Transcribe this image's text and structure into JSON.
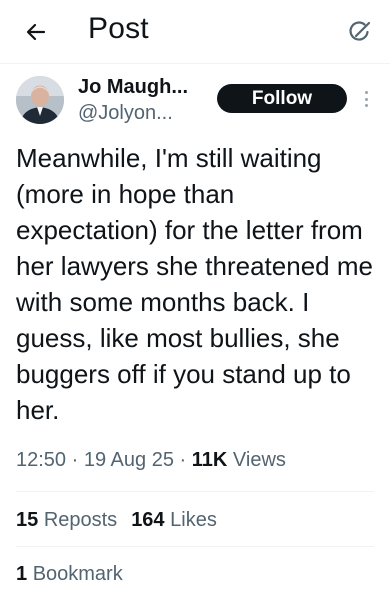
{
  "header": {
    "back_icon": "arrow-left-icon",
    "title": "Post",
    "grok_icon": "grok-icon"
  },
  "author": {
    "name": "Jo Maugh...",
    "handle": "@Jolyon...",
    "follow_label": "Follow",
    "more_icon": "more-vertical-icon"
  },
  "tweet": {
    "text": "Meanwhile, I'm still waiting (more in hope than expectation) for the letter from her lawyers she threatened me with some months back. I guess, like most bullies, she buggers off if you stand up to her.",
    "time": "12:50",
    "date": "19 Aug 25",
    "views_count": "11K",
    "views_label": "Views",
    "separator": "·"
  },
  "stats": {
    "reposts_count": "15",
    "reposts_label": "Reposts",
    "likes_count": "164",
    "likes_label": "Likes",
    "bookmarks_count": "1",
    "bookmarks_label": "Bookmark"
  },
  "colors": {
    "text": "#0f1419",
    "secondary": "#536471",
    "divider": "#eff3f4",
    "follow_bg": "#0f1419"
  }
}
